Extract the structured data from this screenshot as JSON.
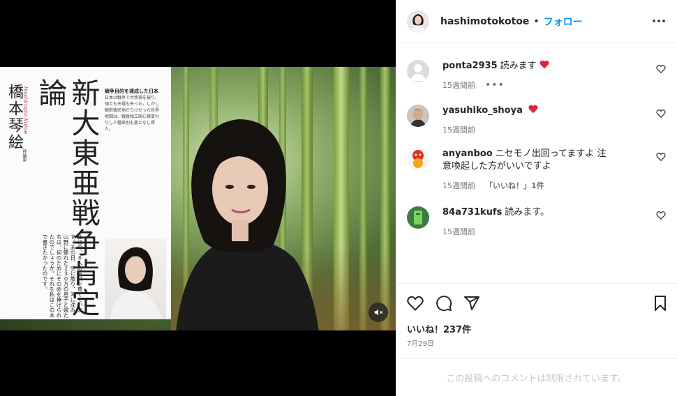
{
  "post": {
    "username": "hashimotokotoe",
    "separator": "•",
    "follow_label": "フォロー",
    "likes_text": "いいね！237件",
    "date": "7月29日",
    "comments_closed": "この投稿へのコメントは制限されています。"
  },
  "book": {
    "title": "新大東亜戦争肯定論",
    "author": "橋本琴絵",
    "author_en": "Hashimoto Kotoe",
    "role": "評論家",
    "blurb_head": "戦争目的を達成した日本",
    "blurb": "日本は戦争で大惨禍を被り、領土も市場も失った。しかし戦前植民地だらけだった世界地図は、戦後独立国に様変わりし人種差別も悪となし得た。",
    "body": "私は今、６人の子供を育てています。あの日、空に散り、海に沈み、山野に斃れた２３０万の息子と娘たちは、何のためにその命を捧げられたのでしょうか。それを私はこの本で書きたかったのです。"
  },
  "comments": [
    {
      "user": "ponta2935",
      "text": "読みます",
      "heart": true,
      "time": "15週間前",
      "more": "•••"
    },
    {
      "user": "yasuhiko_shoya",
      "text": "",
      "heart": true,
      "time": "15週間前"
    },
    {
      "user": "anyanboo",
      "text": "ニセモノ出回ってますよ 注意喚起した方がいいですよ",
      "heart": false,
      "time": "15週間前",
      "reply": "「いいね！」1件"
    },
    {
      "user": "84a731kufs",
      "text": "読みます。",
      "heart": false,
      "time": "15週間前"
    }
  ],
  "icons": {
    "more": "more-horizontal-icon",
    "like": "heart-icon",
    "comment": "comment-icon",
    "share": "share-icon",
    "save": "bookmark-icon",
    "mute": "mute-icon"
  },
  "colors": {
    "follow": "#0095f6",
    "heart": "#ff3040",
    "text": "#262626",
    "muted": "#737373"
  }
}
